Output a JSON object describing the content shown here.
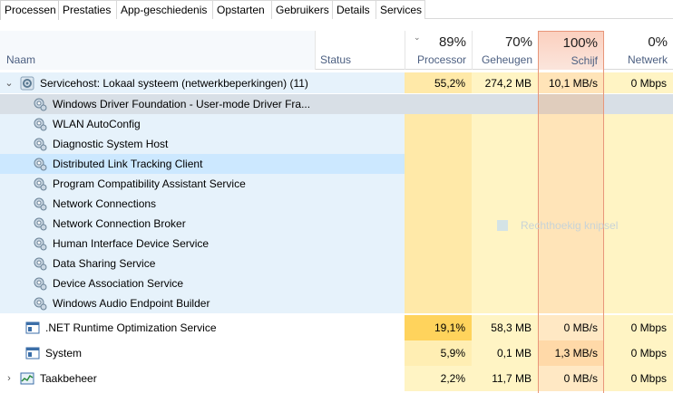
{
  "tabs": [
    {
      "label": "Processen",
      "active": true
    },
    {
      "label": "Prestaties"
    },
    {
      "label": "App-geschiedenis"
    },
    {
      "label": "Opstarten"
    },
    {
      "label": "Gebruikers"
    },
    {
      "label": "Details"
    },
    {
      "label": "Services"
    }
  ],
  "columns": {
    "naam": "Naam",
    "status": "Status",
    "processor": {
      "pct": "89%",
      "label": "Processor"
    },
    "geheugen": {
      "pct": "70%",
      "label": "Geheugen"
    },
    "schijf": {
      "pct": "100%",
      "label": "Schijf"
    },
    "netwerk": {
      "pct": "0%",
      "label": "Netwerk"
    }
  },
  "group": {
    "name": "Servicehost: Lokaal systeem (netwerkbeperkingen) (11)",
    "processor": "55,2%",
    "geheugen": "274,2 MB",
    "schijf": "10,1 MB/s",
    "netwerk": "0 Mbps",
    "children": [
      "Windows Driver Foundation - User-mode Driver Fra...",
      "WLAN AutoConfig",
      "Diagnostic System Host",
      "Distributed Link Tracking Client",
      "Program Compatibility Assistant Service",
      "Network Connections",
      "Network Connection Broker",
      "Human Interface Device Service",
      "Data Sharing Service",
      "Device Association Service",
      "Windows Audio Endpoint Builder"
    ]
  },
  "processes": [
    {
      "name": ".NET Runtime Optimization Service",
      "processor": "19,1%",
      "geheugen": "58,3 MB",
      "schijf": "0 MB/s",
      "netwerk": "0 Mbps"
    },
    {
      "name": "System",
      "processor": "5,9%",
      "geheugen": "0,1 MB",
      "schijf": "1,3 MB/s",
      "netwerk": "0 Mbps"
    },
    {
      "name": "Taakbeheer",
      "processor": "2,2%",
      "geheugen": "11,7 MB",
      "schijf": "0 MB/s",
      "netwerk": "0 Mbps"
    }
  ],
  "watermark": "Rechthoekig knipsel",
  "colors": {
    "selected_row": "#cce8ff",
    "highlight_row": "#d8dfe6",
    "group_bg": "#e6f2fb",
    "heat_light": "#fff4c4",
    "heat_mid": "#ffe9a8",
    "heat_strong": "#ffd35c",
    "schijf_border": "#e8967a"
  }
}
